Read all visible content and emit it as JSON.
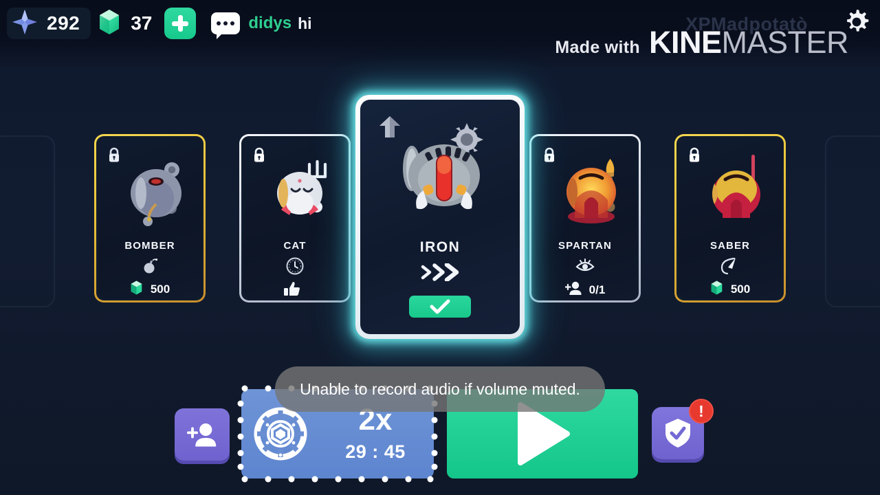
{
  "topbar": {
    "star_icon": "star-compass-icon",
    "star_value": "292",
    "gem_icon": "gem-icon",
    "gem_value": "37",
    "plus_icon": "plus-icon",
    "chat_icon": "chat-bubble-icon",
    "chat_name": "didys",
    "chat_message": "hi",
    "gear_icon": "gear-icon"
  },
  "watermark": {
    "made_with": "Made with",
    "kine": "KINE",
    "master": "MASTER",
    "username": "XPMadpotatò"
  },
  "colors": {
    "accent_green": "#21cf93",
    "accent_cyan": "#6eeef0",
    "gold_border": "#f0cb42",
    "silver_border": "#e7ecf4",
    "purple_button": "#7468d5",
    "blue_button": "#5f87d0",
    "alert_red": "#e8392f",
    "background": "#101a2e"
  },
  "cards": [
    {
      "id": "bomber",
      "name": "BOMBER",
      "border": "gold",
      "locked": true,
      "lock_icon": "lock-icon",
      "trait_icon": "bomb-icon",
      "cost_icon": "gem-icon",
      "cost": "500",
      "selected": false
    },
    {
      "id": "cat",
      "name": "CAT",
      "border": "silver",
      "locked": true,
      "lock_icon": "lock-icon",
      "trait_icon": "clock-icon",
      "cost_icon": "thumbs-up-icon",
      "cost": "",
      "selected": false
    },
    {
      "id": "iron",
      "name": "IRON",
      "border": "selected",
      "locked": false,
      "lock_icon": "upgrade-arrow-icon",
      "trait_icon": "speed-chevrons-icon",
      "cost_icon": "check-icon",
      "cost": "",
      "selected": true,
      "select_button": "check-icon"
    },
    {
      "id": "spartan",
      "name": "SPARTAN",
      "border": "silver",
      "locked": true,
      "lock_icon": "lock-icon",
      "trait_icon": "eye-icon",
      "cost_icon": "add-person-icon",
      "cost": "0/1",
      "selected": false
    },
    {
      "id": "saber",
      "name": "SABER",
      "border": "gold",
      "locked": true,
      "lock_icon": "lock-icon",
      "trait_icon": "crescent-blade-icon",
      "cost_icon": "gem-icon",
      "cost": "500",
      "selected": false
    }
  ],
  "toast": {
    "message": "Unable to record audio if volume muted."
  },
  "bottom": {
    "add_friend_icon": "add-person-icon",
    "boost_icon": "gem-wheel-icon",
    "boost_multiplier": "2x",
    "boost_timer": "29 : 45",
    "play_icon": "play-triangle-icon",
    "shield_icon": "shield-check-icon",
    "alert_badge": "!"
  }
}
